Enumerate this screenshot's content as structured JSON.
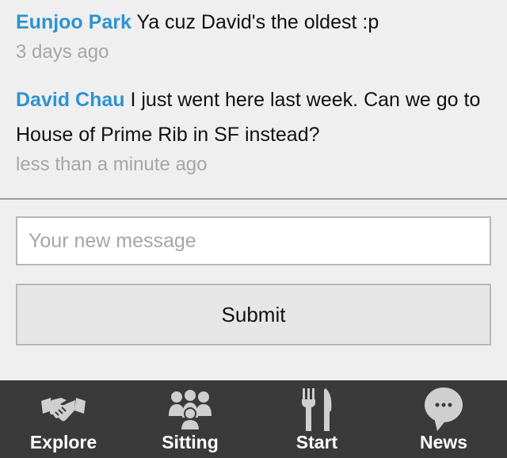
{
  "messages": [
    {
      "author": "Eunjoo Park",
      "text": "Ya cuz David's the oldest :p",
      "time": "3 days ago"
    },
    {
      "author": "David Chau",
      "text": "I just went here last week. Can we go to House of Prime Rib in SF instead?",
      "time": "less than a minute ago"
    }
  ],
  "composer": {
    "placeholder": "Your new message",
    "submit_label": "Submit"
  },
  "tabbar": {
    "items": [
      {
        "label": "Explore",
        "icon": "handshake-icon"
      },
      {
        "label": "Sitting",
        "icon": "group-icon"
      },
      {
        "label": "Start",
        "icon": "fork-knife-icon"
      },
      {
        "label": "News",
        "icon": "speech-bubble-icon"
      }
    ]
  },
  "colors": {
    "author": "#2f93cf",
    "timestamp": "#a6a6a6",
    "tabbar_bg": "#3a3a3a",
    "background": "#efefef"
  }
}
